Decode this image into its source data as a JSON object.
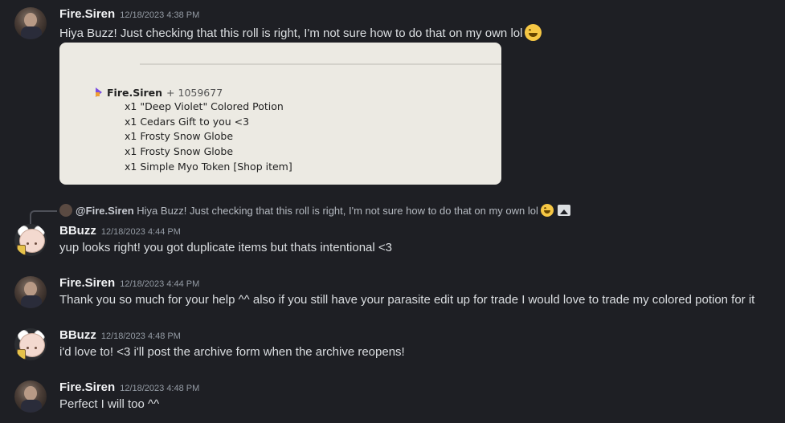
{
  "messages": [
    {
      "username": "Fire.Siren",
      "timestamp": "12/18/2023 4:38 PM",
      "text": "Hiya Buzz! Just checking that this roll is right, I'm not sure how to do that on my own lol",
      "emoji": "grinning-smile-emoji",
      "attachment": {
        "roller_name": "Fire.Siren",
        "roller_id": "+ 1059677",
        "items": [
          "x1 \"Deep Violet\" Colored Potion",
          "x1 Cedars Gift to you <3",
          "x1 Frosty Snow Globe",
          "x1 Frosty Snow Globe",
          "x1 Simple Myo Token [Shop item]"
        ]
      }
    },
    {
      "reply": {
        "username": "@Fire.Siren",
        "text": "Hiya Buzz! Just checking that this roll is right, I'm not sure how to do that on my own lol"
      },
      "username": "BBuzz",
      "timestamp": "12/18/2023 4:44 PM",
      "text": "yup looks right! you got duplicate items but thats intentional <3"
    },
    {
      "username": "Fire.Siren",
      "timestamp": "12/18/2023 4:44 PM",
      "text": "Thank you so much for your help ^^ also if you still have your parasite edit up for trade I would love to trade my colored potion for it"
    },
    {
      "username": "BBuzz",
      "timestamp": "12/18/2023 4:48 PM",
      "text": "i'd love to! <3 i'll post the archive form when the archive reopens!"
    },
    {
      "username": "Fire.Siren",
      "timestamp": "12/18/2023 4:48 PM",
      "text": "Perfect I will too ^^"
    }
  ],
  "colors": {
    "background": "#1e1f24",
    "username": "#f2f3f5",
    "timestamp": "#949ba4",
    "text": "#dbdee1",
    "attachment_bg": "#eceae3"
  }
}
